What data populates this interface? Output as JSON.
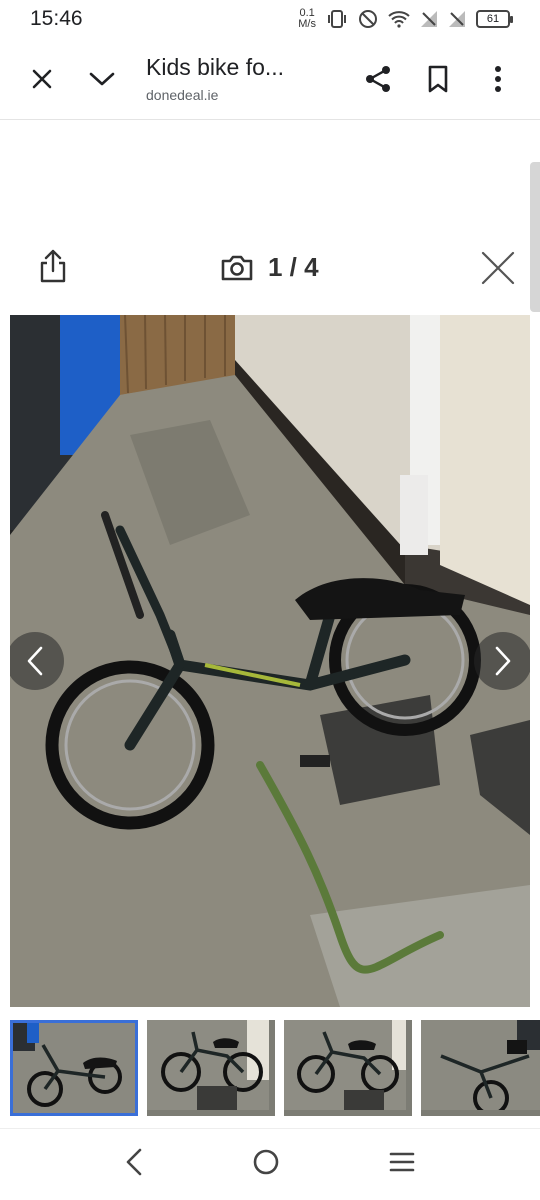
{
  "status": {
    "time": "15:46",
    "net_speed_value": "0.1",
    "net_speed_unit": "M/s",
    "battery": "61"
  },
  "browser": {
    "title": "Kids bike fo...",
    "url": "donedeal.ie"
  },
  "viewer": {
    "counter": "1 / 4"
  },
  "gallery": {
    "thumbnail_count": 4,
    "selected_index": 0
  }
}
